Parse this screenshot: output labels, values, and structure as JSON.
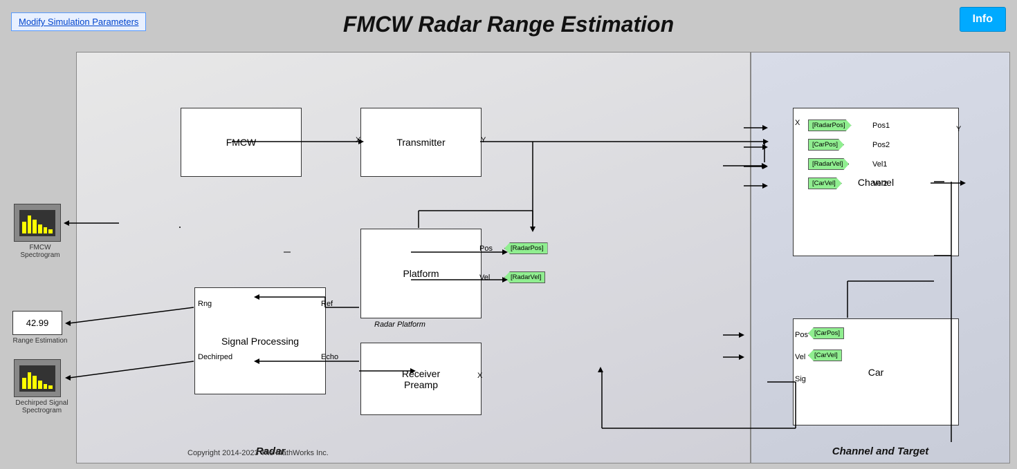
{
  "header": {
    "title": "FMCW Radar Range Estimation",
    "modify_btn": "Modify Simulation Parameters",
    "info_btn": "Info"
  },
  "diagram": {
    "radar_label": "Radar",
    "channel_label": "Channel and Target",
    "copyright": "Copyright 2014-2023 The MathWorks Inc.",
    "blocks": {
      "fmcw": "FMCW",
      "transmitter": "Transmitter",
      "platform": "Platform",
      "radar_platform_label": "Radar Platform",
      "signal_processing": "Signal Processing",
      "receiver_preamp": "Receiver\nPreamp",
      "channel": "Channel",
      "car": "Car"
    },
    "ports": {
      "transmitter_x": "X",
      "transmitter_y": "Y",
      "channel_x": "X",
      "channel_pos1": "Pos1",
      "channel_pos2": "Pos2",
      "channel_vel1": "Vel1",
      "channel_vel2": "Vel2",
      "channel_y": "Y",
      "platform_pos": "Pos",
      "platform_vel": "Vel",
      "sp_rng": "Rng",
      "sp_ref": "Ref",
      "sp_dechirped": "Dechirped",
      "sp_echo": "Echo",
      "car_pos": "Pos",
      "car_vel": "Vel",
      "car_sig": "Sig",
      "receiver_x": "X"
    },
    "signal_tags": {
      "radar_pos": "[RadarPos]",
      "car_pos": "[CarPos]",
      "radar_vel": "[RadarVel]",
      "car_vel": "[CarVel]"
    },
    "scopes": {
      "fmcw_spectrogram": "FMCW Spectrogram",
      "range_estimation": "Range Estimation",
      "range_value": "42.99",
      "dechirped_spectrogram": "Dechirped Signal\nSpectrogram"
    }
  }
}
